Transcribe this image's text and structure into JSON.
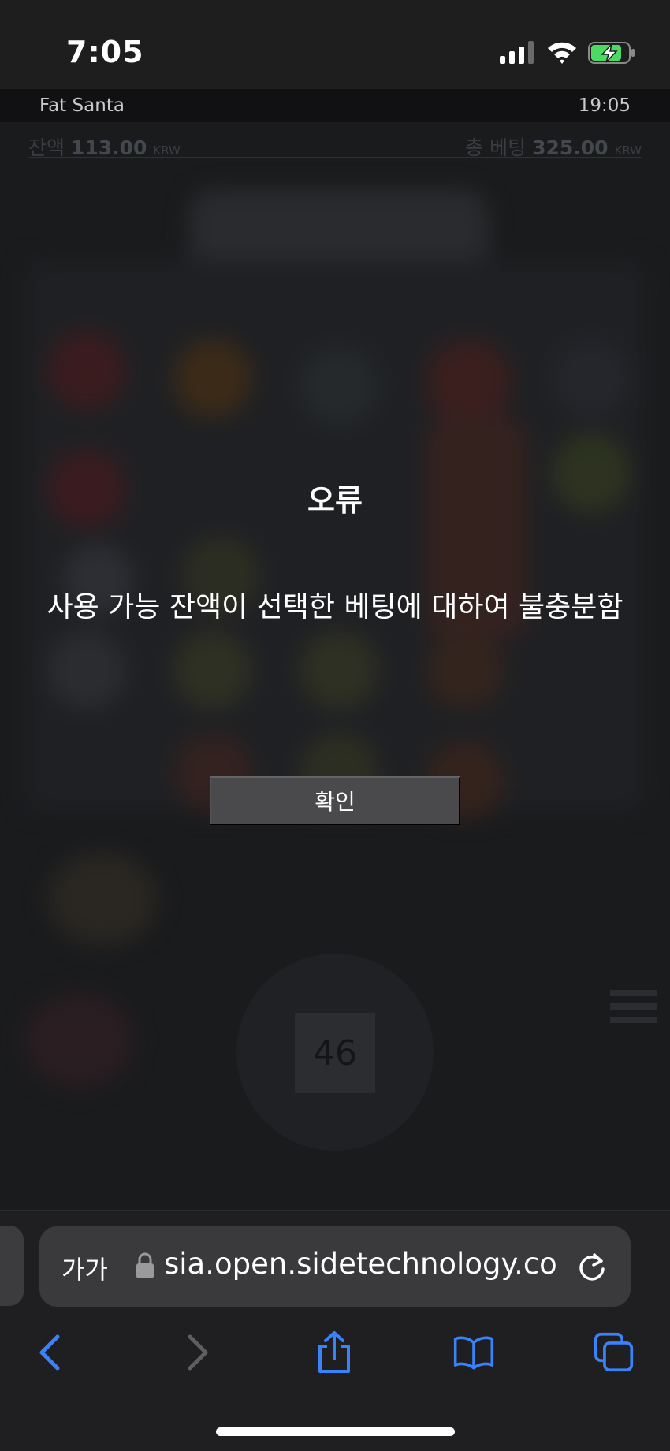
{
  "status_bar": {
    "time": "7:05"
  },
  "game": {
    "title": "Fat Santa",
    "clock": "19:05",
    "balance_label": "잔액",
    "balance_value": "113.00",
    "balance_currency": "KRW",
    "total_bet_label": "총 베팅",
    "total_bet_value": "325.00",
    "total_bet_currency": "KRW",
    "spin_value": "46"
  },
  "dialog": {
    "title": "오류",
    "message": "사용 가능 잔액이 선택한 베팅에 대하여 불충분함",
    "confirm_label": "확인"
  },
  "safari": {
    "text_size_label": "가가",
    "url": "sia.open.sidetechnology.co"
  },
  "colors": {
    "accent": "#3a82f7",
    "battery_green": "#4cd964",
    "overlay": "#1b1c1e"
  }
}
